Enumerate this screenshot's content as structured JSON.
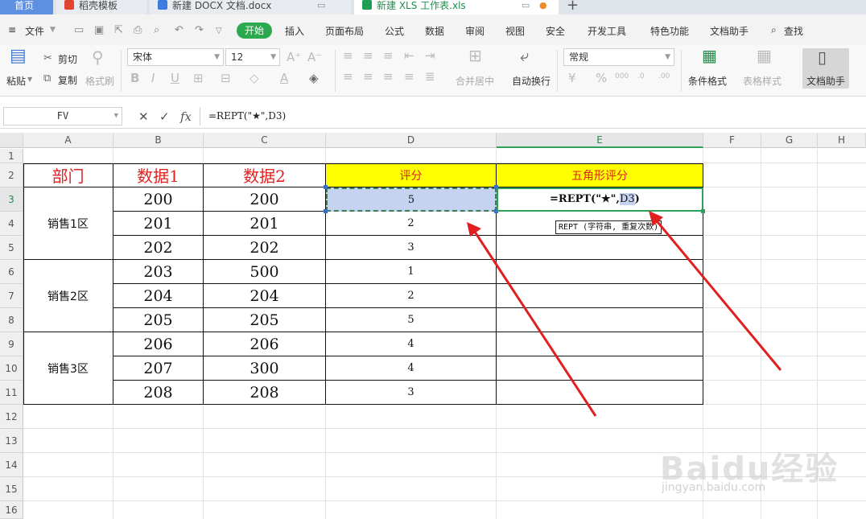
{
  "tabs": {
    "home": "首页",
    "daoke": "稻壳模板",
    "docx": "新建 DOCX 文档.docx",
    "xls": "新建 XLS 工作表.xls"
  },
  "menu": {
    "file": "文件",
    "start": "开始",
    "items": [
      "插入",
      "页面布局",
      "公式",
      "数据",
      "审阅",
      "视图",
      "安全",
      "开发工具",
      "特色功能",
      "文档助手"
    ],
    "search": "查找"
  },
  "toolbar": {
    "paste": "粘贴",
    "cut": "剪切",
    "copy": "复制",
    "format_painter": "格式刷",
    "font_name": "宋体",
    "font_size": "12",
    "merge_center": "合并居中",
    "auto_wrap": "自动换行",
    "number_format": "常规",
    "conditional_format": "条件格式",
    "table_style": "表格样式",
    "doc_helper": "文档助手"
  },
  "formula_bar": {
    "name_box": "FV",
    "formula": "=REPT(\"★\",D3)"
  },
  "grid": {
    "columns": [
      "A",
      "B",
      "C",
      "D",
      "E",
      "F",
      "G",
      "H"
    ],
    "rows": [
      "1",
      "2",
      "3",
      "4",
      "5",
      "6",
      "7",
      "8",
      "9",
      "10",
      "11",
      "12",
      "13",
      "14",
      "15",
      "16"
    ],
    "headers": {
      "dept": "部门",
      "data1": "数据1",
      "data2": "数据2",
      "score": "评分",
      "star_score": "五角形评分"
    },
    "departments": [
      "销售1区",
      "销售2区",
      "销售3区"
    ],
    "data1": [
      "200",
      "201",
      "202",
      "203",
      "204",
      "205",
      "206",
      "207",
      "208"
    ],
    "data2": [
      "200",
      "201",
      "202",
      "500",
      "204",
      "205",
      "206",
      "300",
      "208"
    ],
    "scores": [
      "5",
      "2",
      "3",
      "1",
      "2",
      "5",
      "4",
      "4",
      "3"
    ],
    "editing": {
      "prefix": "=REPT(\"★\",",
      "ref": "D3",
      "suffix": ")"
    },
    "tooltip": "REPT (字符串, 重复次数)"
  },
  "annotation_color": "#e02020",
  "watermark": {
    "main": "Baidu经验",
    "sub": "jingyan.baidu.com"
  }
}
